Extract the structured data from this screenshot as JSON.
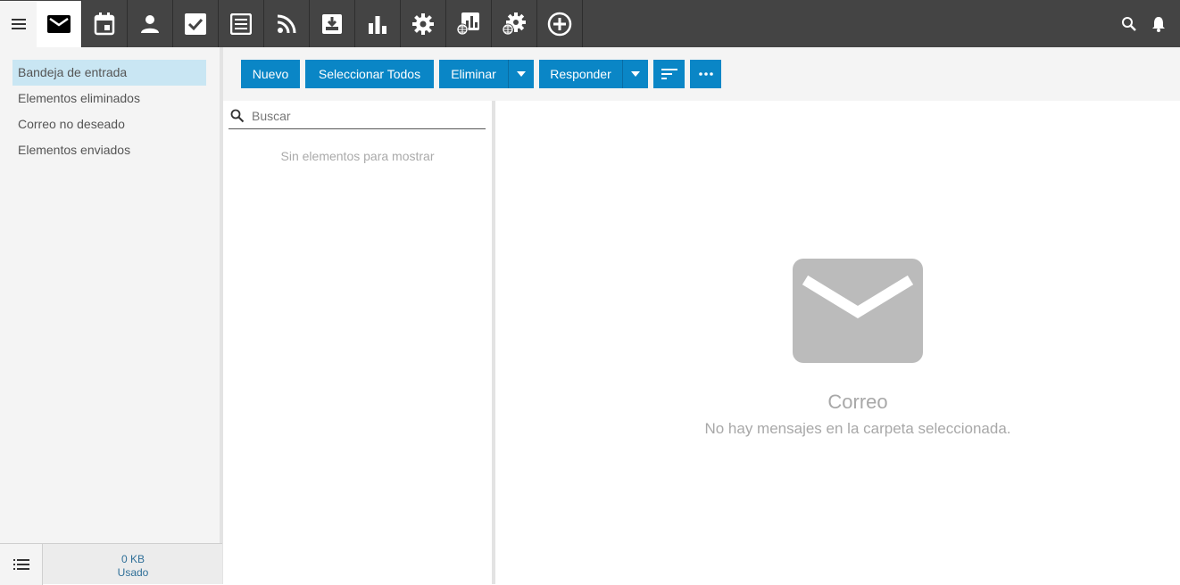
{
  "nav": {
    "menu_icon": "hamburger-menu-icon",
    "apps": [
      {
        "icon": "mail-icon",
        "active": true
      },
      {
        "icon": "calendar-icon"
      },
      {
        "icon": "contacts-icon"
      },
      {
        "icon": "tasks-icon"
      },
      {
        "icon": "notes-icon"
      },
      {
        "icon": "rss-icon"
      },
      {
        "icon": "archive-icon"
      },
      {
        "icon": "reports-icon"
      },
      {
        "icon": "settings-icon"
      },
      {
        "icon": "web-reports-icon"
      },
      {
        "icon": "web-settings-icon"
      },
      {
        "icon": "add-app-icon"
      }
    ],
    "right_icons": [
      "search-icon",
      "notifications-icon"
    ]
  },
  "sidebar": {
    "folders": [
      {
        "label": "Bandeja de entrada",
        "selected": true
      },
      {
        "label": "Elementos eliminados"
      },
      {
        "label": "Correo no deseado"
      },
      {
        "label": "Elementos enviados"
      }
    ],
    "usage_value": "0 KB",
    "usage_label": "Usado"
  },
  "toolbar": {
    "new_label": "Nuevo",
    "select_all_label": "Seleccionar Todos",
    "delete_label": "Eliminar",
    "reply_label": "Responder",
    "sort_icon": "sort-icon",
    "more_icon": "more-icon"
  },
  "list": {
    "search_placeholder": "Buscar",
    "empty_text": "Sin elementos para mostrar"
  },
  "reading": {
    "title": "Correo",
    "subtitle": "No hay mensajes en la carpeta seleccionada."
  },
  "colors": {
    "topbar": "#444444",
    "accent": "#0a86c6",
    "selected_folder": "#c9e6f3"
  }
}
